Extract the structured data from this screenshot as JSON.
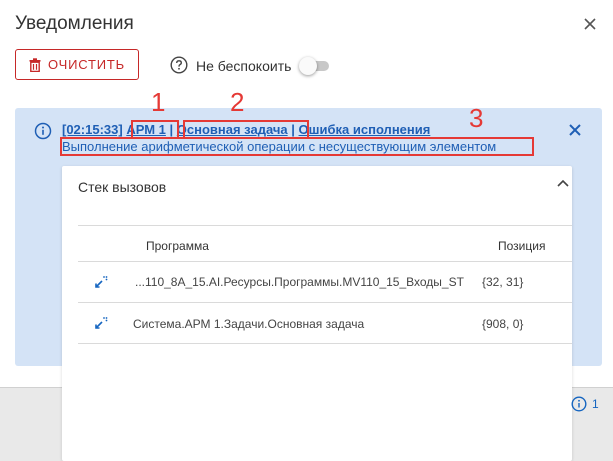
{
  "header": {
    "title": "Уведомления"
  },
  "toolbar": {
    "clear_label": "ОЧИСТИТЬ",
    "dnd_label": "Не беспокоить",
    "dnd_enabled": false
  },
  "notification": {
    "time": "[02:15:33]",
    "workstation": "АРМ 1",
    "separator": "|",
    "task": "Основная задача",
    "type": "Ошибка исполнения",
    "message": "Выполнение арифметической операции с несуществующим элементом"
  },
  "annotations": {
    "n1": "1",
    "n2": "2",
    "n3": "3"
  },
  "call_stack": {
    "title": "Стек вызовов",
    "columns": {
      "program": "Программа",
      "position": "Позиция"
    },
    "rows": [
      {
        "program": "...110_8A_15.AI.Ресурсы.Программы.MV110_15_Входы_ST",
        "position": "{32, 31}"
      },
      {
        "program": "Система.АРМ 1.Задачи.Основная задача",
        "position": "{908, 0}"
      }
    ]
  },
  "footer": {
    "count": "1"
  },
  "colors": {
    "accent": "#1f5fb5",
    "danger": "#c62828",
    "notification_bg": "#d4e3f6",
    "highlight": "#e53935"
  }
}
